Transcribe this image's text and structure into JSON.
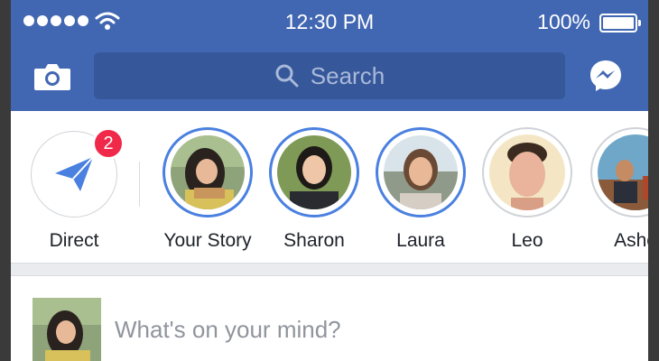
{
  "status_bar": {
    "time": "12:30 PM",
    "battery_percent": "100%",
    "signal_bars": 5,
    "wifi": true
  },
  "nav": {
    "search_placeholder": "Search",
    "camera_icon": "camera-icon",
    "messenger_icon": "messenger-icon",
    "colors": {
      "bar": "#4267b2",
      "search_field": "#36589a"
    }
  },
  "stories": {
    "direct": {
      "label": "Direct",
      "badge_count": "2",
      "icon": "paper-plane-icon"
    },
    "items": [
      {
        "label": "Your Story",
        "seen": false
      },
      {
        "label": "Sharon",
        "seen": false
      },
      {
        "label": "Laura",
        "seen": false
      },
      {
        "label": "Leo",
        "seen": true
      },
      {
        "label": "Asho",
        "seen": true
      }
    ],
    "colors": {
      "unseen_ring": "#4a80e0",
      "seen_ring": "#cfd3d8",
      "badge": "#f02849"
    }
  },
  "composer": {
    "placeholder": "What's on your mind?"
  }
}
